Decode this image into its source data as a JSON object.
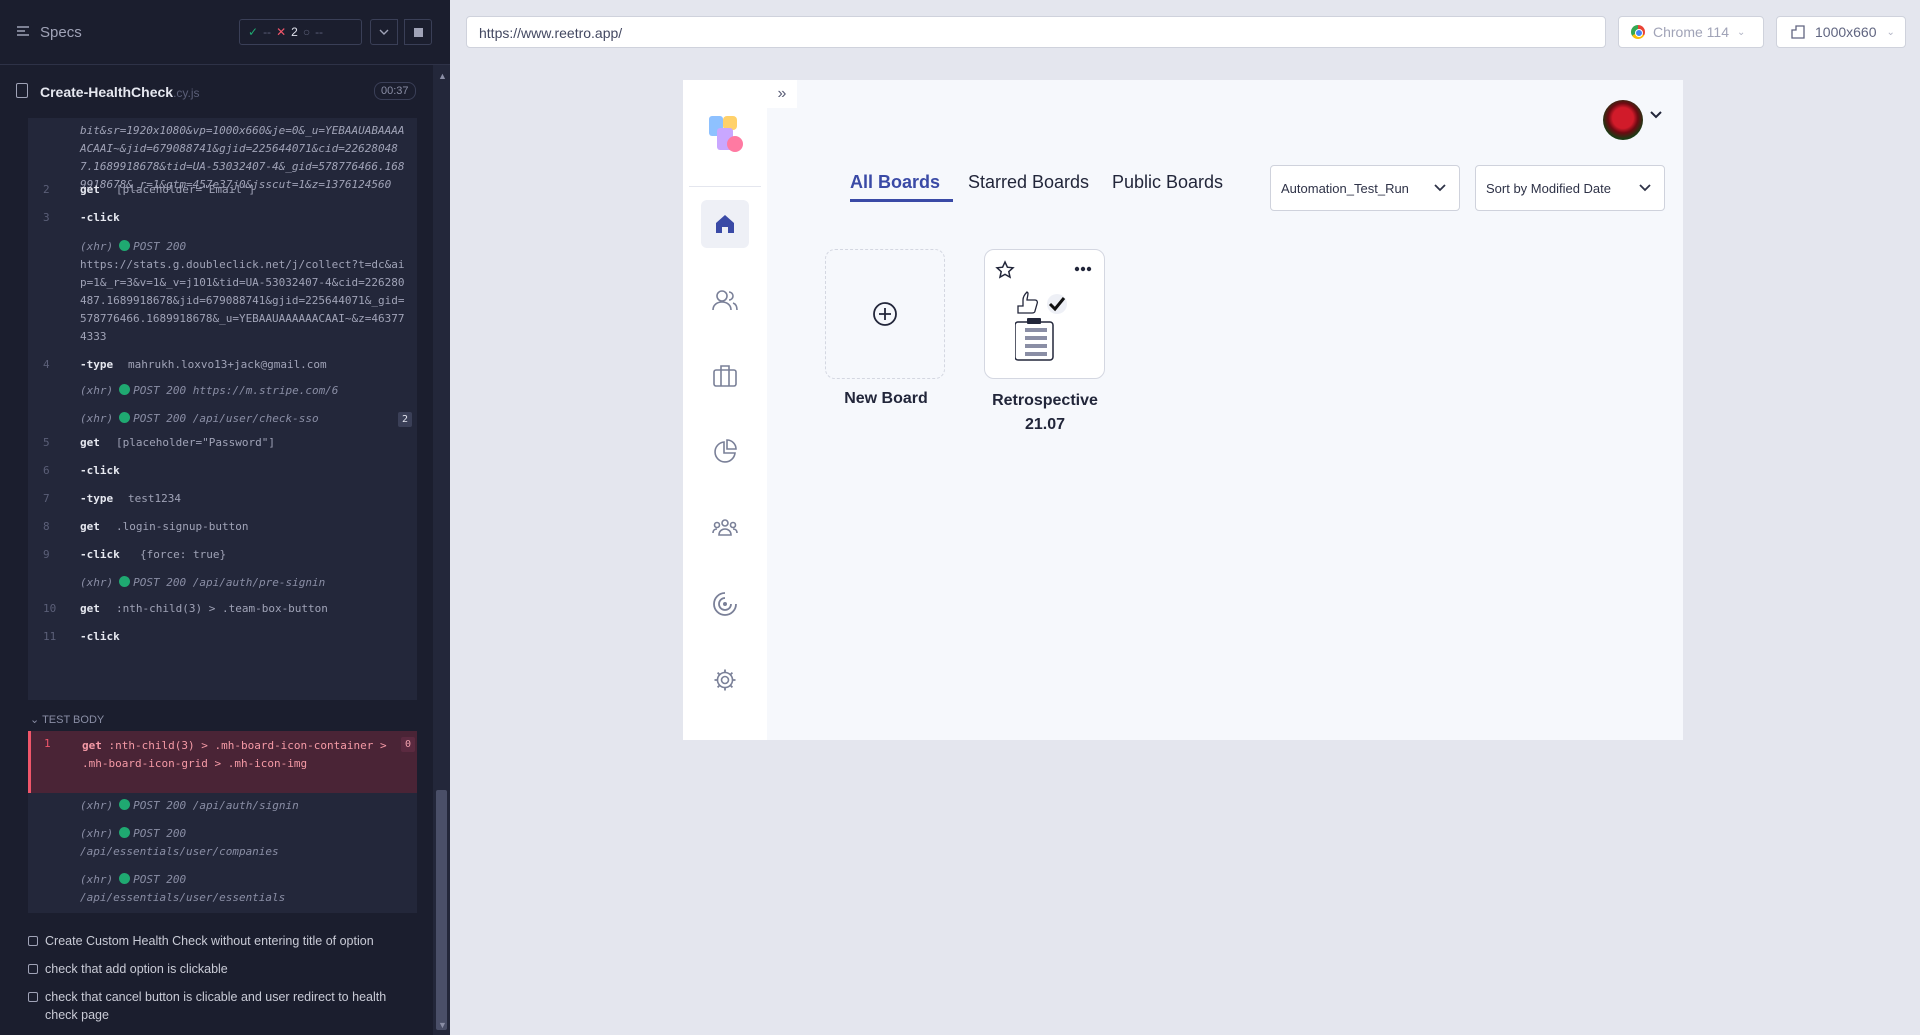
{
  "runner": {
    "specs_label": "Specs",
    "stats": {
      "passed": "--",
      "failed": "2",
      "pending": "--"
    },
    "spec_name": "Create-HealthCheck",
    "spec_ext": ".cy.js",
    "duration": "00:37",
    "test_body_label": "TEST BODY"
  },
  "log": {
    "top_url": "bit&sr=1920x1080&vp=1000x660&je=0&_u=YEBAAUABAAAAACAAI~&jid=679088741&gjid=225644071&cid=226280487.1689918678&tid=UA-53032407-4&_gid=578776466.1689918678&_r=1&gtm=457e37j0&jsscut=1&z=1376124560",
    "commands": [
      {
        "no": "2",
        "name": "get",
        "msg": "[placeholder=\"Email\"]"
      },
      {
        "no": "3",
        "name": "-click",
        "msg": ""
      },
      {
        "no": "4",
        "name": "-type",
        "msg": "mahrukh.loxvo13+jack@gmail.com"
      },
      {
        "no": "5",
        "name": "get",
        "msg": "[placeholder=\"Password\"]"
      },
      {
        "no": "6",
        "name": "-click",
        "msg": ""
      },
      {
        "no": "7",
        "name": "-type",
        "msg": "test1234"
      },
      {
        "no": "8",
        "name": "get",
        "msg": ".login-signup-button"
      },
      {
        "no": "9",
        "name": "-click",
        "msg": "{force: true}"
      },
      {
        "no": "10",
        "name": "get",
        "msg": ":nth-child(3) > .team-box-button"
      },
      {
        "no": "11",
        "name": "-click",
        "msg": ""
      }
    ],
    "xhr_tag": "(xhr)",
    "xhr_status": "POST 200",
    "xhr_collect_url": "https://stats.g.doubleclick.net/j/collect?t=dc&aip=1&_r=3&v=1&_v=j101&tid=UA-53032407-4&cid=226280487.1689918678&jid=679088741&gjid=225644071&_gid=578776466.1689918678&_u=YEBAAUAAAAAACAAI~&z=463774333",
    "xhr_stripe": "https://m.stripe.com/6",
    "xhr_check_sso": "/api/user/check-sso",
    "xhr_check_sso_count": "2",
    "xhr_pre_signin": "/api/auth/pre-signin"
  },
  "test_body": {
    "failed_no": "1",
    "failed_name": "get",
    "failed_msg": ":nth-child(3) > .mh-board-icon-container > .mh-board-icon-grid > .mh-icon-img",
    "failed_count": "0",
    "xhr_signin": "/api/auth/signin",
    "xhr_companies": "/api/essentials/user/companies",
    "xhr_essentials": "/api/essentials/user/essentials"
  },
  "tests": [
    "Create Custom Health Check without entering title of option",
    "check that add option is clickable",
    "check that cancel button is clicable and user redirect to health check page"
  ],
  "browser": {
    "url": "https://www.reetro.app/",
    "name": "Chrome 114",
    "viewport": "1000x660"
  },
  "app": {
    "tabs": {
      "all": "All Boards",
      "starred": "Starred Boards",
      "public": "Public Boards"
    },
    "team_select": "Automation_Test_Run",
    "sort_select": "Sort by Modified Date",
    "new_board": "New Board",
    "retro_board_line1": "Retrospective",
    "retro_board_line2": "21.07",
    "brand_color": "#3a4aa6"
  }
}
